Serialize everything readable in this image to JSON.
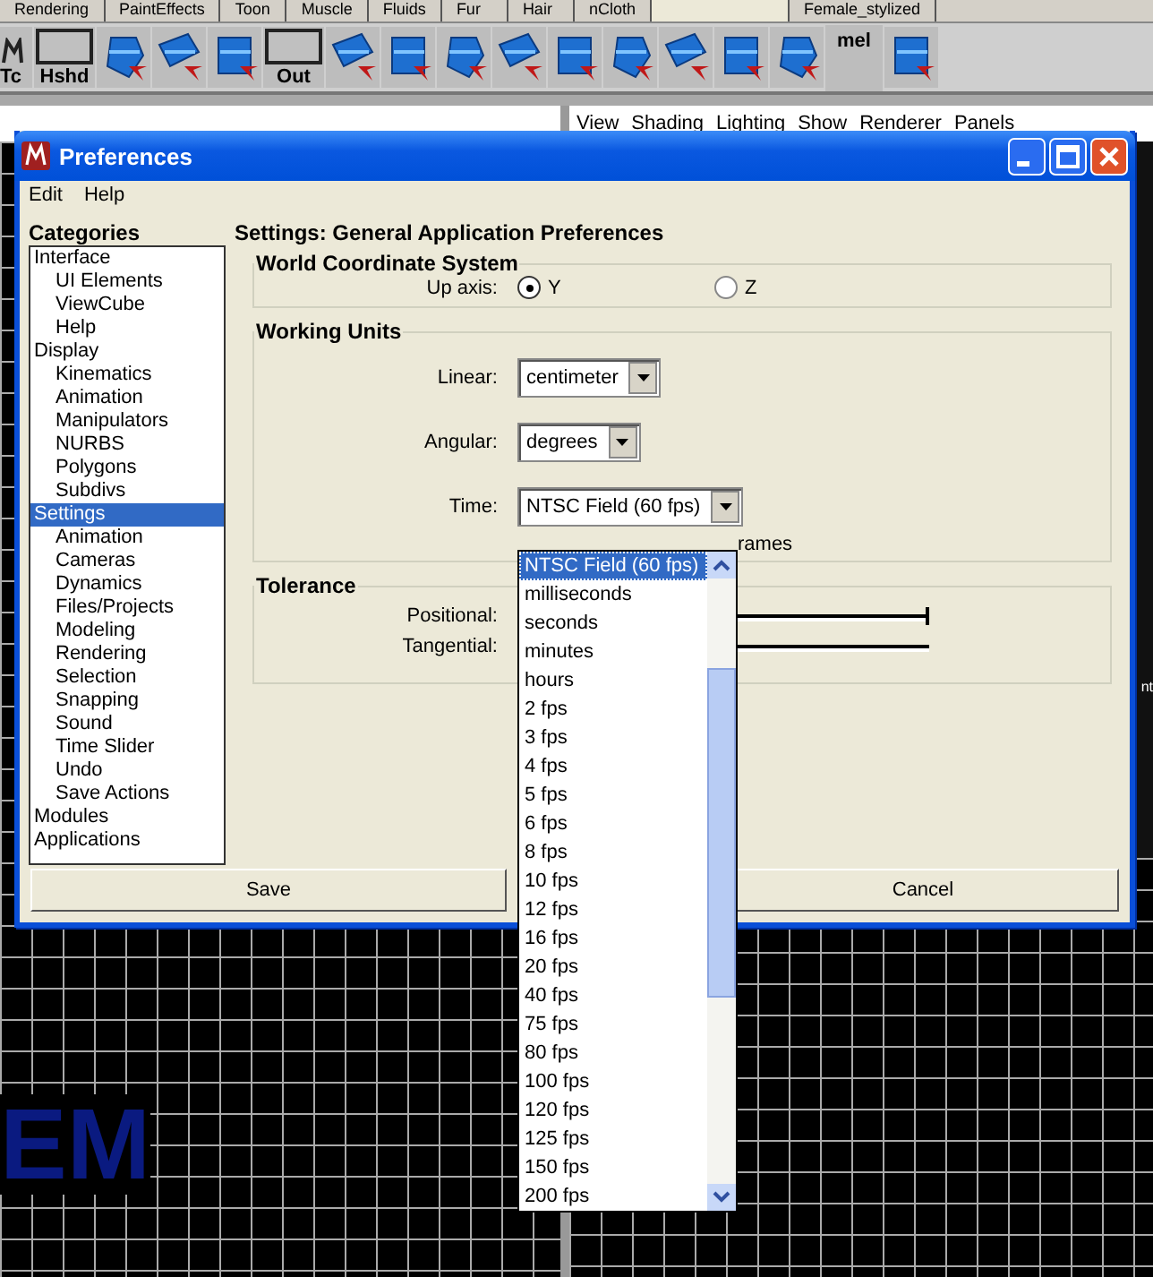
{
  "shelf_tabs": [
    {
      "label": "Rendering",
      "selected": false
    },
    {
      "label": "PaintEffects",
      "selected": false
    },
    {
      "label": "Toon",
      "selected": false
    },
    {
      "label": "Muscle",
      "selected": false
    },
    {
      "label": "Fluids",
      "selected": false
    },
    {
      "label": "Fur",
      "selected": false
    },
    {
      "label": "Hair",
      "selected": false
    },
    {
      "label": "nCloth",
      "selected": false
    },
    {
      "selected": true
    },
    {
      "label": "Female_stylized",
      "selected": false
    }
  ],
  "shelf": [
    {
      "kind": "logo",
      "text": "Tc"
    },
    {
      "kind": "screen",
      "text": "Hshd"
    },
    {
      "kind": "tool"
    },
    {
      "kind": "tool"
    },
    {
      "kind": "tool"
    },
    {
      "kind": "screen",
      "text": "Out"
    },
    {
      "kind": "tool"
    },
    {
      "kind": "tool"
    },
    {
      "kind": "tool"
    },
    {
      "kind": "tool"
    },
    {
      "kind": "tool"
    },
    {
      "kind": "tool"
    },
    {
      "kind": "tool"
    },
    {
      "kind": "tool"
    },
    {
      "kind": "tool"
    },
    {
      "kind": "mel",
      "text": "mel"
    },
    {
      "kind": "tool"
    }
  ],
  "viewport_menu": [
    "View",
    "Shading",
    "Lighting",
    "Show",
    "Renderer",
    "Panels"
  ],
  "viewport_text": "EM",
  "side_text": "nt",
  "dialog": {
    "title": "Preferences",
    "menu": [
      "Edit",
      "Help"
    ],
    "categories_heading": "Categories",
    "categories": [
      {
        "label": "Interface",
        "selected": false,
        "children": [
          {
            "label": "UI Elements",
            "selected": false
          },
          {
            "label": "ViewCube",
            "selected": false
          },
          {
            "label": "Help",
            "selected": false
          }
        ]
      },
      {
        "label": "Display",
        "selected": false,
        "children": [
          {
            "label": "Kinematics",
            "selected": false
          },
          {
            "label": "Animation",
            "selected": false
          },
          {
            "label": "Manipulators",
            "selected": false
          },
          {
            "label": "NURBS",
            "selected": false
          },
          {
            "label": "Polygons",
            "selected": false
          },
          {
            "label": "Subdivs",
            "selected": false
          }
        ]
      },
      {
        "label": "Settings",
        "selected": true,
        "children": [
          {
            "label": "Animation",
            "selected": false
          },
          {
            "label": "Cameras",
            "selected": false
          },
          {
            "label": "Dynamics",
            "selected": false
          },
          {
            "label": "Files/Projects",
            "selected": false
          },
          {
            "label": "Modeling",
            "selected": false
          },
          {
            "label": "Rendering",
            "selected": false
          },
          {
            "label": "Selection",
            "selected": false
          },
          {
            "label": "Snapping",
            "selected": false
          },
          {
            "label": "Sound",
            "selected": false
          },
          {
            "label": "Time Slider",
            "selected": false
          },
          {
            "label": "Undo",
            "selected": false
          },
          {
            "label": "Save Actions",
            "selected": false
          }
        ]
      },
      {
        "label": "Modules",
        "selected": false
      },
      {
        "label": "Applications",
        "selected": false
      }
    ],
    "settings_heading": "Settings: General Application Preferences",
    "world": {
      "title": "World Coordinate System",
      "label": "Up axis:",
      "options": [
        {
          "label": "Y",
          "selected": true
        },
        {
          "label": "Z",
          "selected": false
        }
      ]
    },
    "units": {
      "title": "Working Units",
      "fields": [
        {
          "label": "Linear:",
          "value": "centimeter"
        },
        {
          "label": "Angular:",
          "value": "degrees"
        },
        {
          "label": "Time:",
          "value": "NTSC Field (60 fps)"
        }
      ],
      "hidden_label": "rames"
    },
    "tolerance": {
      "title": "Tolerance",
      "sliders": [
        {
          "label": "Positional:",
          "level": 1
        },
        {
          "label": "Tangential:",
          "level": 0
        }
      ]
    },
    "buttons": [
      "Save",
      "Cancel"
    ]
  },
  "time_list": [
    {
      "label": "NTSC Field (60 fps)",
      "selected": true
    },
    {
      "label": "milliseconds",
      "selected": false
    },
    {
      "label": "seconds",
      "selected": false
    },
    {
      "label": "minutes",
      "selected": false
    },
    {
      "label": "hours",
      "selected": false
    },
    {
      "label": "2 fps",
      "selected": false
    },
    {
      "label": "3 fps",
      "selected": false
    },
    {
      "label": "4 fps",
      "selected": false
    },
    {
      "label": "5 fps",
      "selected": false
    },
    {
      "label": "6 fps",
      "selected": false
    },
    {
      "label": "8 fps",
      "selected": false
    },
    {
      "label": "10 fps",
      "selected": false
    },
    {
      "label": "12 fps",
      "selected": false
    },
    {
      "label": "16 fps",
      "selected": false
    },
    {
      "label": "20 fps",
      "selected": false
    },
    {
      "label": "40 fps",
      "selected": false
    },
    {
      "label": "75 fps",
      "selected": false
    },
    {
      "label": "80 fps",
      "selected": false
    },
    {
      "label": "100 fps",
      "selected": false
    },
    {
      "label": "120 fps",
      "selected": false
    },
    {
      "label": "125 fps",
      "selected": false
    },
    {
      "label": "150 fps",
      "selected": false
    },
    {
      "label": "200 fps",
      "selected": false
    }
  ]
}
